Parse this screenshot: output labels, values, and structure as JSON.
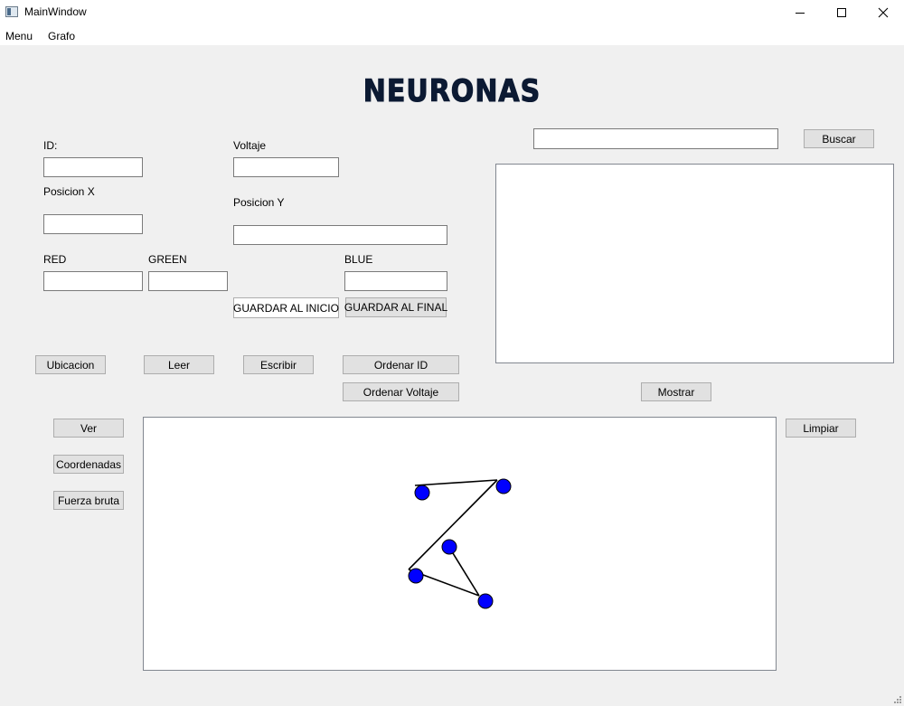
{
  "window": {
    "title": "MainWindow",
    "app_icon": "app-window-icon"
  },
  "menu": {
    "items": [
      "Menu",
      "Grafo"
    ]
  },
  "heading": "NEURONAS",
  "form": {
    "id_label": "ID:",
    "id_value": "",
    "voltaje_label": "Voltaje",
    "voltaje_value": "",
    "posx_label": "Posicion X",
    "posx_value": "",
    "posy_label": "Posicion Y",
    "posy_value": "",
    "red_label": "RED",
    "red_value": "",
    "green_label": "GREEN",
    "green_value": "",
    "blue_label": "BLUE",
    "blue_value": "",
    "guardar_inicio": "GUARDAR AL INICIO",
    "guardar_final": "GUARDAR AL FINAL"
  },
  "actions": {
    "ubicacion": "Ubicacion",
    "leer": "Leer",
    "escribir": "Escribir",
    "ordenar_id": "Ordenar ID",
    "ordenar_voltaje": "Ordenar Voltaje"
  },
  "search": {
    "value": "",
    "button": "Buscar"
  },
  "display": {
    "mostrar": "Mostrar"
  },
  "graph": {
    "ver": "Ver",
    "coordenadas": "Coordenadas",
    "fuerza_bruta": "Fuerza bruta",
    "limpiar": "Limpiar",
    "node_color": "#0000ff"
  }
}
